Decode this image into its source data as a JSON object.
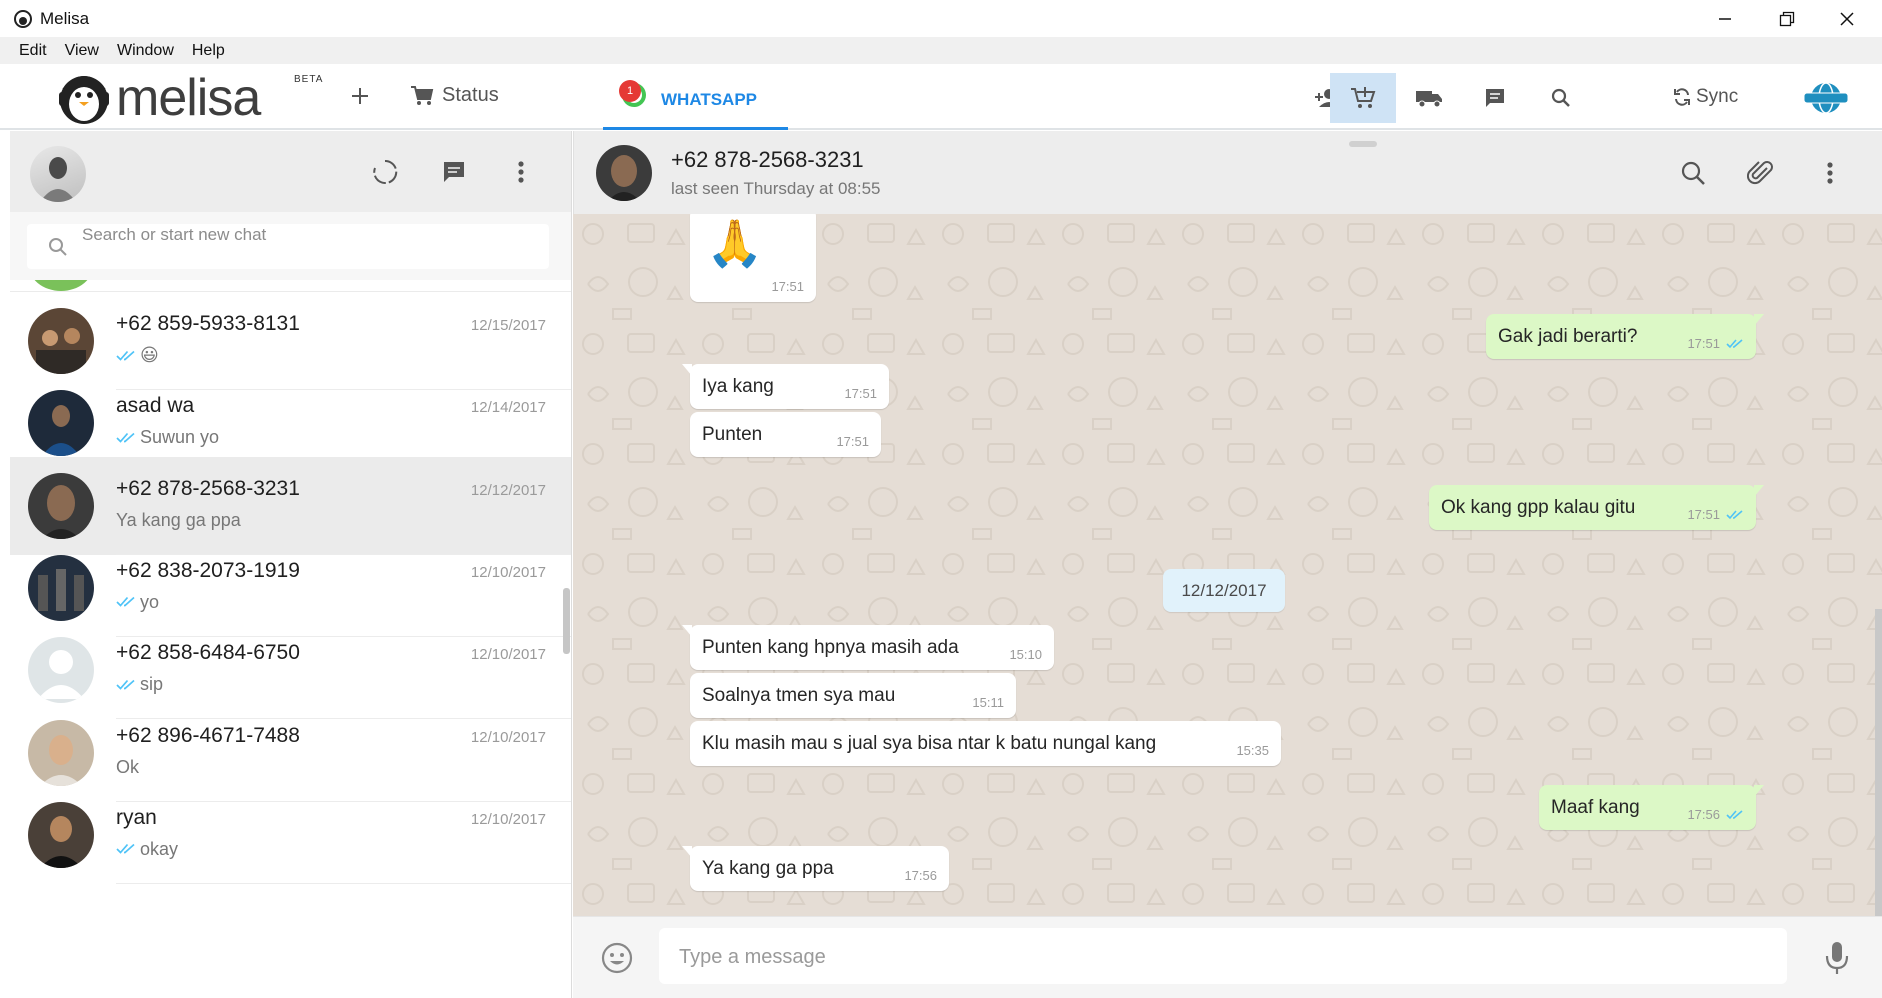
{
  "window": {
    "title": "Melisa"
  },
  "menu": [
    "Edit",
    "View",
    "Window",
    "Help"
  ],
  "toolbar": {
    "logo_text": "melisa",
    "beta": "BETA",
    "status_label": "Status",
    "tab_label": "WHATSAPP",
    "tab_badge": "1",
    "sync_label": "Sync"
  },
  "search": {
    "placeholder": "Search or start new chat"
  },
  "chats": [
    {
      "name": "+62 859-5933-8131",
      "date": "12/15/2017",
      "last": "😃",
      "ticks": true,
      "selected": false
    },
    {
      "name": "asad wa",
      "date": "12/14/2017",
      "last": "Suwun yo",
      "ticks": true,
      "selected": false
    },
    {
      "name": "+62 878-2568-3231",
      "date": "12/12/2017",
      "last": "Ya kang ga ppa",
      "ticks": false,
      "selected": true
    },
    {
      "name": "+62 838-2073-1919",
      "date": "12/10/2017",
      "last": "yo",
      "ticks": true,
      "selected": false
    },
    {
      "name": "+62 858-6484-6750",
      "date": "12/10/2017",
      "last": "sip",
      "ticks": true,
      "selected": false
    },
    {
      "name": "+62 896-4671-7488",
      "date": "12/10/2017",
      "last": "Ok",
      "ticks": false,
      "selected": false
    },
    {
      "name": "ryan",
      "date": "12/10/2017",
      "last": "okay",
      "ticks": true,
      "selected": false
    }
  ],
  "conversation": {
    "contact": "+62 878-2568-3231",
    "status": "last seen Thursday at 08:55",
    "date_divider": "12/12/2017",
    "messages": [
      {
        "dir": "in",
        "text": "🙏",
        "time": "17:51"
      },
      {
        "dir": "out",
        "text": "Gak jadi berarti?",
        "time": "17:51"
      },
      {
        "dir": "in",
        "text": "Iya kang",
        "time": "17:51"
      },
      {
        "dir": "in",
        "text": "Punten",
        "time": "17:51"
      },
      {
        "dir": "out",
        "text": "Ok kang gpp kalau gitu",
        "time": "17:51"
      },
      {
        "dir": "in",
        "text": "Punten kang hpnya masih ada",
        "time": "15:10"
      },
      {
        "dir": "in",
        "text": "Soalnya tmen sya mau",
        "time": "15:11"
      },
      {
        "dir": "in",
        "text": "Klu masih mau s jual sya bisa ntar k batu nungal kang",
        "time": "15:35"
      },
      {
        "dir": "out",
        "text": "Maaf kang",
        "time": "17:56"
      },
      {
        "dir": "in",
        "text": "Ya kang ga ppa",
        "time": "17:56"
      }
    ]
  },
  "composer": {
    "placeholder": "Type a message"
  },
  "colors": {
    "accent": "#1e88e5",
    "bubble_out": "#dcf8c6",
    "bubble_in": "#ffffff",
    "chat_bg": "#e5ddd5",
    "badge": "#e53935"
  },
  "icons": [
    "menu-dots-icon",
    "status-loop-icon",
    "new-chat-icon",
    "search-icon",
    "attach-icon",
    "emoji-icon",
    "mic-icon",
    "add-contact-icon",
    "cart-icon",
    "truck-icon",
    "message-icon",
    "sync-icon",
    "plus-icon"
  ]
}
